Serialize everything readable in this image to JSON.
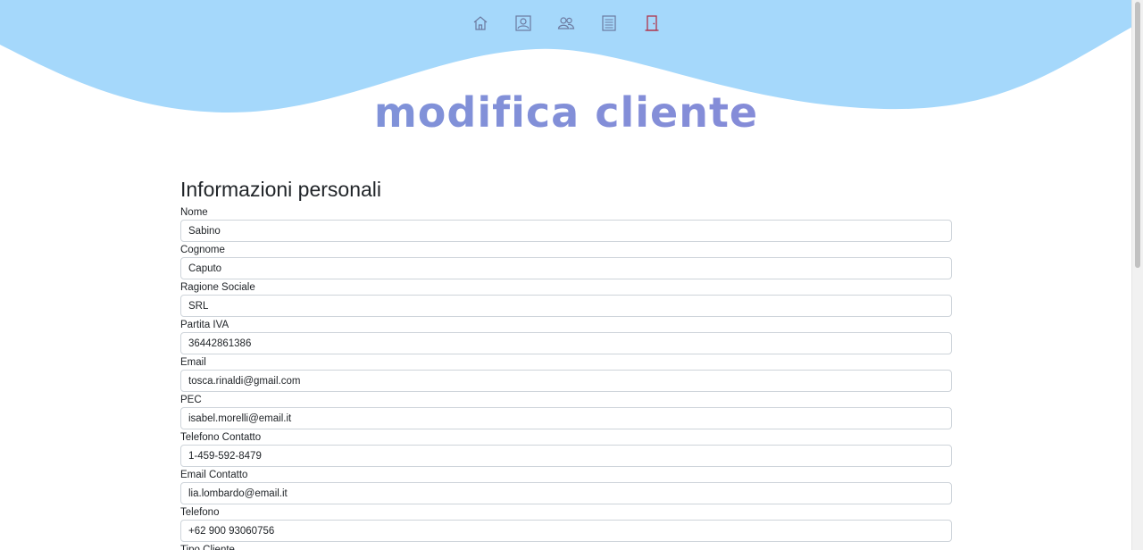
{
  "brand": {
    "title": "modifica cliente"
  },
  "nav": {
    "items": [
      {
        "icon": "home-icon"
      },
      {
        "icon": "user-card-icon"
      },
      {
        "icon": "users-icon"
      },
      {
        "icon": "list-icon"
      },
      {
        "icon": "logout-door-icon"
      }
    ]
  },
  "colors": {
    "wave": "#a5d8fb",
    "brand_gradient_start": "#7b98d9",
    "brand_gradient_end": "#8a86d8",
    "nav_icon": "#6c7aa0",
    "logout_icon": "#b0344b"
  },
  "form": {
    "section_title": "Informazioni personali",
    "fields": [
      {
        "label": "Nome",
        "value": "Sabino"
      },
      {
        "label": "Cognome",
        "value": "Caputo"
      },
      {
        "label": "Ragione Sociale",
        "value": "SRL"
      },
      {
        "label": "Partita IVA",
        "value": "36442861386"
      },
      {
        "label": "Email",
        "value": "tosca.rinaldi@gmail.com"
      },
      {
        "label": "PEC",
        "value": "isabel.morelli@email.it"
      },
      {
        "label": "Telefono Contatto",
        "value": "1-459-592-8479"
      },
      {
        "label": "Email Contatto",
        "value": "lia.lombardo@email.it"
      },
      {
        "label": "Telefono",
        "value": "+62 900 93060756"
      }
    ],
    "next_label": "Tipo Cliente"
  }
}
